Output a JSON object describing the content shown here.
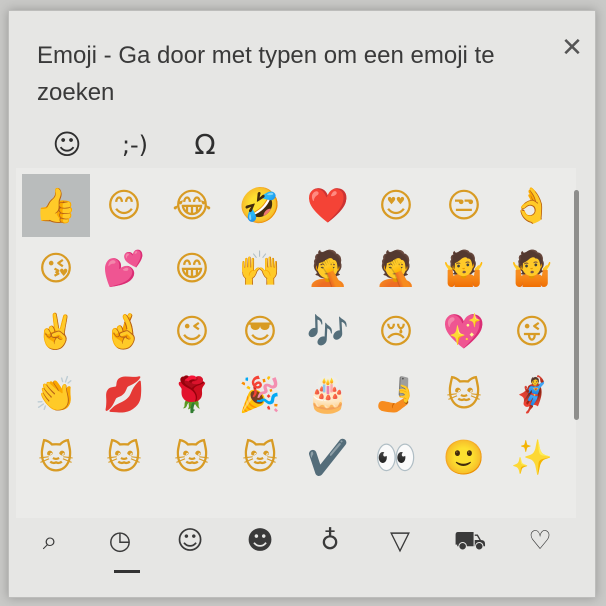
{
  "window": {
    "title": "Emoji - Ga door met typen om een emoji te zoeken",
    "close_glyph": "✕"
  },
  "category_tabs": [
    {
      "name": "smiley-face-icon",
      "glyph": "☺"
    },
    {
      "name": "kaomoji-tab",
      "glyph": ";-)"
    },
    {
      "name": "omega-symbol-icon",
      "glyph": "Ω"
    }
  ],
  "emojis": [
    [
      "👍",
      "😊",
      "😂",
      "🤣",
      "❤️",
      "😍",
      "😒",
      "👌"
    ],
    [
      "😘",
      "💕",
      "😁",
      "🙌",
      "🤦",
      "🤦",
      "🤷",
      "🤷"
    ],
    [
      "✌️",
      "🤞",
      "😉",
      "😎",
      "🎶",
      "😢",
      "💖",
      "😜"
    ],
    [
      "👏",
      "💋",
      "🌹",
      "🎉",
      "🎂",
      "🤳",
      "🐱",
      "🦸"
    ],
    [
      "🐱",
      "🐱",
      "🐱",
      "🐱",
      "✔️",
      "👀",
      "🙂",
      "✨"
    ]
  ],
  "bottom_tabs": [
    {
      "name": "search-icon",
      "glyph": "⌕"
    },
    {
      "name": "recent-clock-icon",
      "glyph": "◷"
    },
    {
      "name": "smiley-category-icon",
      "glyph": "☺"
    },
    {
      "name": "people-category-icon",
      "glyph": "☻"
    },
    {
      "name": "balloon-category-icon",
      "glyph": "♁"
    },
    {
      "name": "food-pizza-icon",
      "glyph": "▽"
    },
    {
      "name": "travel-car-icon",
      "glyph": "⛟"
    },
    {
      "name": "heart-symbols-icon",
      "glyph": "♡"
    }
  ]
}
